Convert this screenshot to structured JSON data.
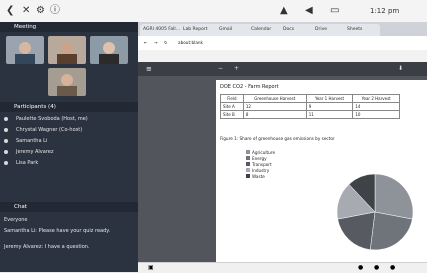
{
  "topbar": {
    "left_icons": [
      "back-icon",
      "close-icon",
      "gear-icon",
      "info-icon"
    ],
    "right_text": "1:12 pm",
    "status_items": [
      "wifi-icon",
      "volume-icon",
      "battery-icon"
    ]
  },
  "meeting": {
    "header": "Meeting",
    "participants_header": "Participants (4)",
    "participants": [
      "Paulette Svoboda (Host, me)",
      "Chrystal Wagner (Co-host)",
      "Samantha Li",
      "Jeremy Alvarez",
      "Lisa Park"
    ],
    "chat_header": "Chat",
    "chat_messages": [
      "Everyone",
      "Samantha Li: Please have your quiz ready.",
      "Jeremy Alvarez: I have a question."
    ]
  },
  "browser": {
    "tabs": [
      "AGRI 4005 Fall...",
      "Lab Report",
      "Gmail",
      "Calendar",
      "Docs",
      "Drive",
      "Sheets"
    ],
    "url": "about:blank",
    "pdf_title": "DOE CO2 - Farm Report",
    "table_headers": [
      "Field",
      "Greenhouse Harvest",
      "Year 1 Harvest",
      "Year 2 Harvest"
    ],
    "table_rows": [
      [
        "Site A",
        "12",
        "9",
        "14"
      ],
      [
        "Site B",
        "8",
        "11",
        "10"
      ]
    ],
    "chart_caption": "Figure 1: Share of greenhouse gas emissions by sector",
    "legend": [
      "Agriculture",
      "Energy",
      "Transport",
      "Industry",
      "Waste"
    ],
    "legend_colors": [
      "#8e939a",
      "#6f747b",
      "#575b61",
      "#a7abb1",
      "#3f4247"
    ]
  },
  "chart_data": {
    "type": "pie",
    "values": [
      28,
      24,
      20,
      16,
      12
    ],
    "labels": [
      "Agriculture",
      "Energy",
      "Transport",
      "Industry",
      "Waste"
    ]
  }
}
